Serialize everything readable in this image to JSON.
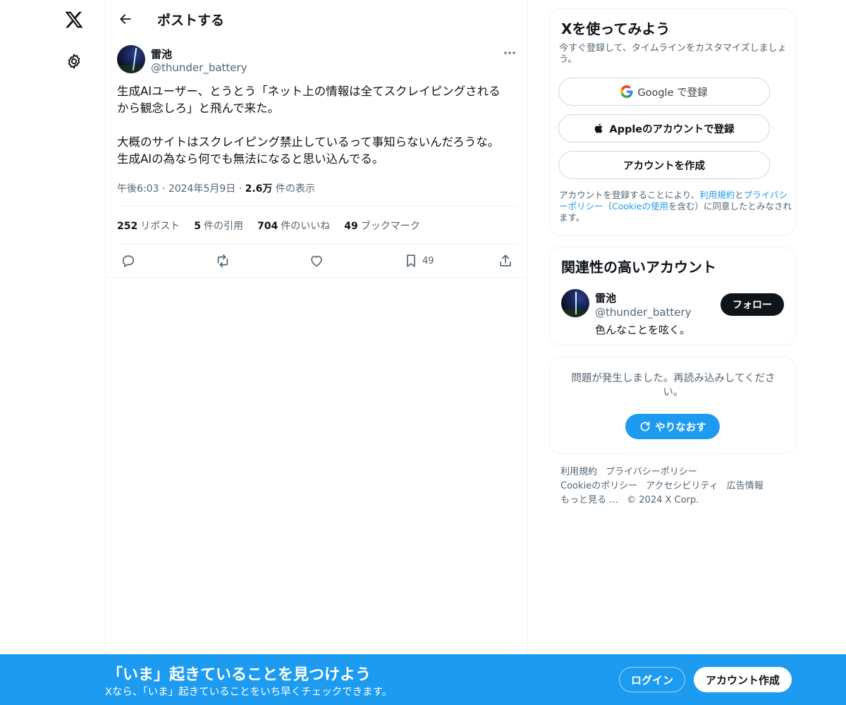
{
  "nav": {
    "logo_icon": "x-logo-icon",
    "settings_icon": "gear-icon"
  },
  "header": {
    "title": "ポストする"
  },
  "tweet": {
    "author_name": "雷池",
    "author_handle": "@thunder_battery",
    "text": "生成AIユーザー、とうとう「ネット上の情報は全てスクレイピングされる\nから観念しろ」と飛んで来た。\n\n大概のサイトはスクレイピング禁止しているって事知らないんだろうな。\n生成AIの為なら何でも無法になると思い込んでる。",
    "time": "午後6:03",
    "date": "2024年5月9日",
    "views_count": "2.6万",
    "views_label": "件の表示",
    "stats": {
      "reposts": "252",
      "reposts_label": "リポスト",
      "quotes": "5",
      "quotes_label": "件の引用",
      "likes": "704",
      "likes_label": "件のいいね",
      "bookmarks": "49",
      "bookmarks_label": "ブックマーク"
    },
    "bookmark_count": "49"
  },
  "signup_panel": {
    "title": "Xを使ってみよう",
    "subtitle": "今すぐ登録して、タイムラインをカスタマイズしましょう。",
    "google_text": "Google で登録",
    "apple_text": "Appleのアカウントで登録",
    "create_text": "アカウントを作成",
    "legal_1": "アカウントを登録することにより、",
    "legal_terms": "利用規約",
    "legal_2": "と",
    "legal_privacy": "プライバシーポリシー",
    "legal_3": "（",
    "legal_cookie": "Cookieの使用",
    "legal_4": "を含む）に同意したとみなされます。"
  },
  "related": {
    "title": "関連性の高いアカウント",
    "name": "雷池",
    "handle": "@thunder_battery",
    "bio": "色んなことを呟く。",
    "follow_label": "フォロー"
  },
  "error_panel": {
    "message": "問題が発生しました。再読み込みしてください。",
    "retry_label": "やりなおす"
  },
  "footer": {
    "terms": "利用規約",
    "privacy": "プライバシーポリシー",
    "cookie": "Cookieのポリシー",
    "accessibility": "アクセシビリティ",
    "ads": "広告情報",
    "more": "もっと見る …",
    "copyright": "© 2024 X Corp."
  },
  "banner": {
    "title": "「いま」起きていることを見つけよう",
    "subtitle": "Xなら、「いま」起きていることをいち早くチェックできます。",
    "login_label": "ログイン",
    "signup_label": "アカウント作成"
  },
  "colors": {
    "accent": "#1d9bf0",
    "text": "#0f1419",
    "muted": "#536471",
    "border": "#eff3f4"
  }
}
